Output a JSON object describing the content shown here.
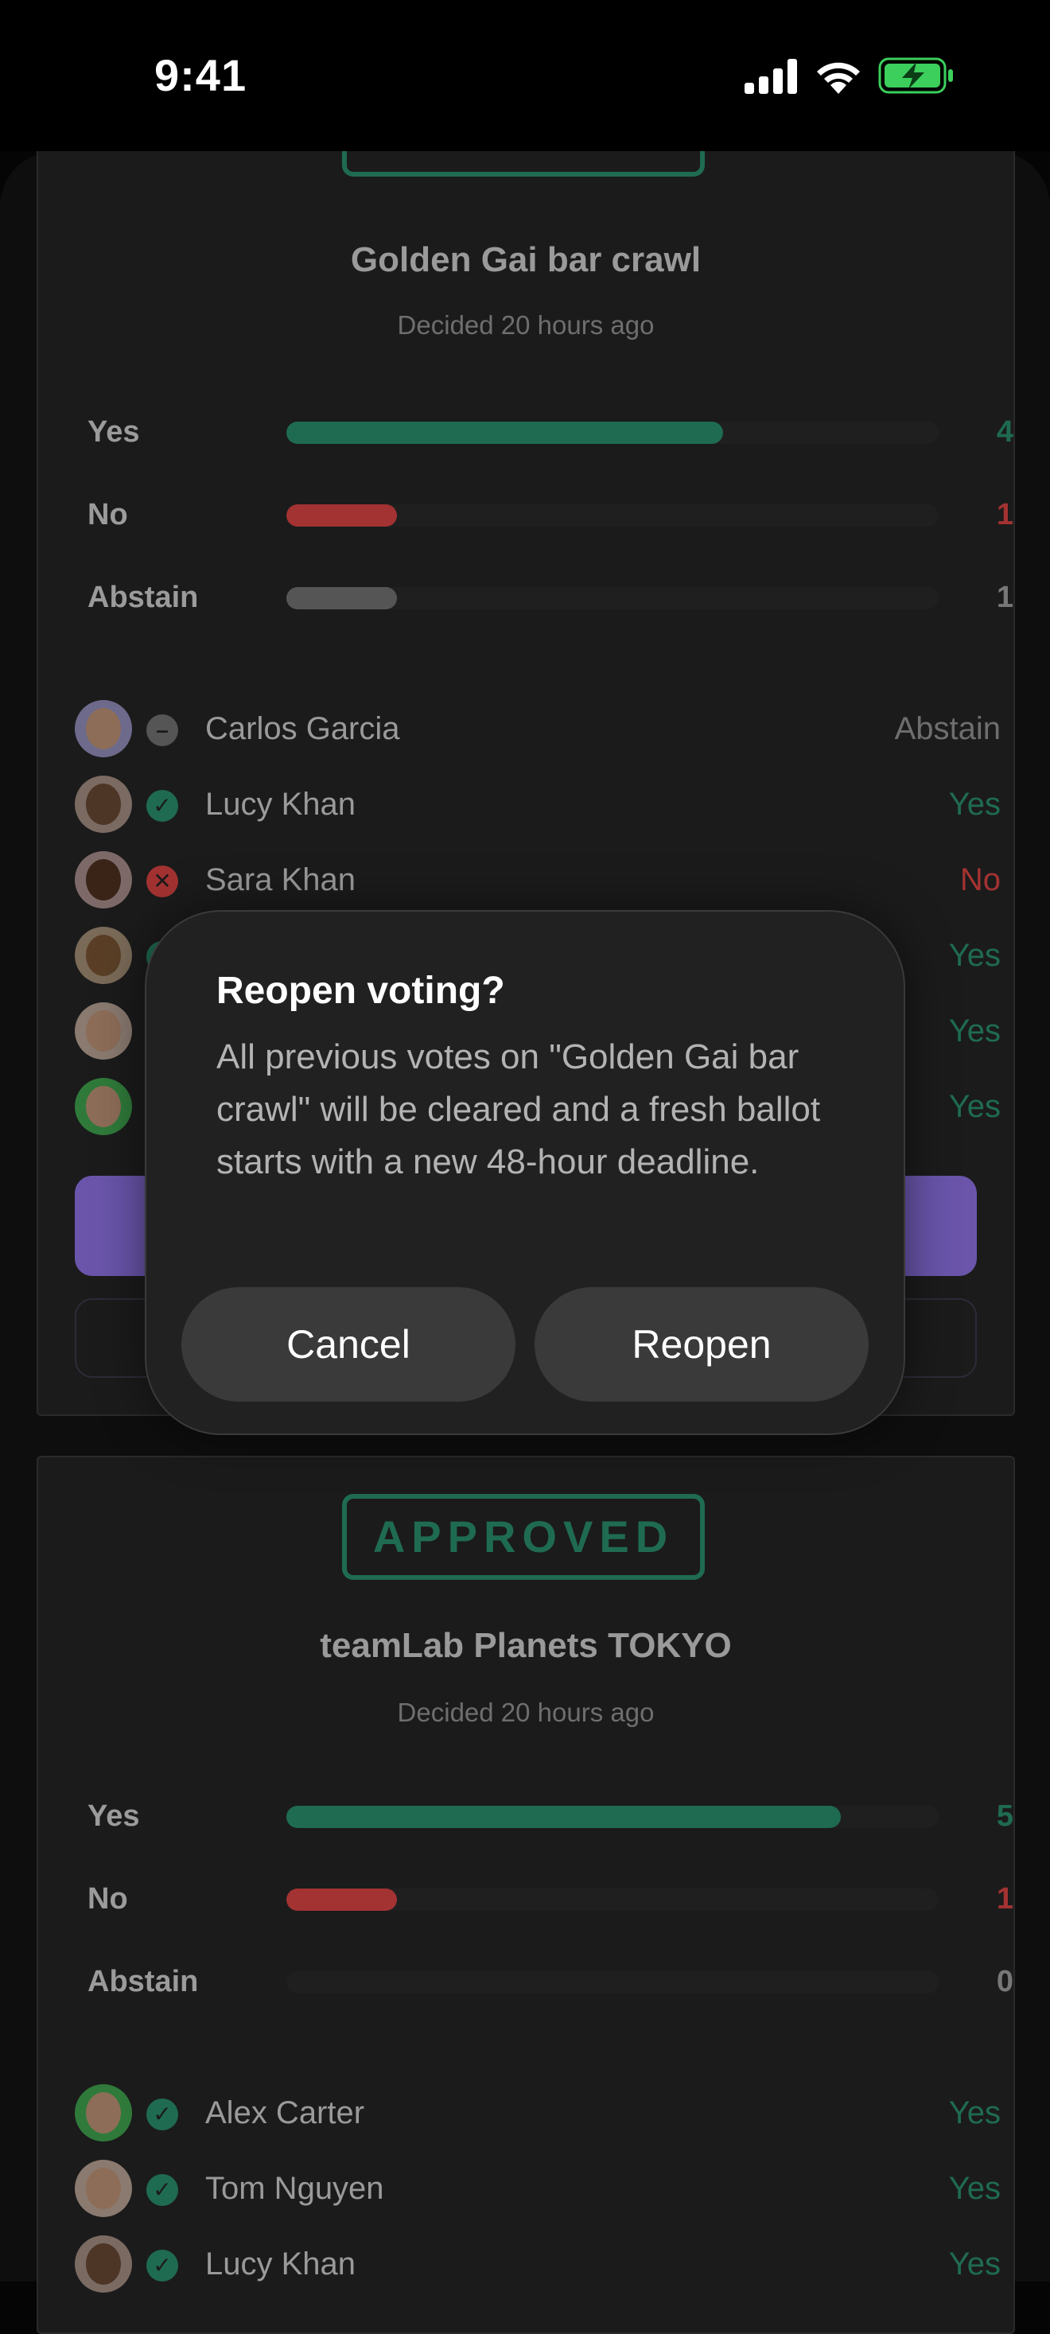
{
  "status_bar": {
    "time": "9:41"
  },
  "cards": [
    {
      "stamp": "",
      "title": "Golden Gai bar crawl",
      "decided": "Decided 20 hours ago",
      "tallies": [
        {
          "label": "Yes",
          "count": "4",
          "fraction": 0.67,
          "color": "#1f6b52"
        },
        {
          "label": "No",
          "count": "1",
          "fraction": 0.17,
          "color": "#a33232"
        },
        {
          "label": "Abstain",
          "count": "1",
          "fraction": 0.17,
          "color": "#555555"
        }
      ],
      "voters": [
        {
          "name": "Carlos Garcia",
          "vote": "Abstain"
        },
        {
          "name": "Lucy Khan",
          "vote": "Yes"
        },
        {
          "name": "Sara Khan",
          "vote": "No"
        },
        {
          "name": "",
          "vote": "Yes"
        },
        {
          "name": "",
          "vote": "Yes"
        },
        {
          "name": "",
          "vote": "Yes"
        }
      ]
    },
    {
      "stamp": "APPROVED",
      "title": "teamLab Planets TOKYO",
      "decided": "Decided 20 hours ago",
      "tallies": [
        {
          "label": "Yes",
          "count": "5",
          "fraction": 0.85,
          "color": "#1f6b52"
        },
        {
          "label": "No",
          "count": "1",
          "fraction": 0.17,
          "color": "#a33232"
        },
        {
          "label": "Abstain",
          "count": "0",
          "fraction": 0,
          "color": "#555555"
        }
      ],
      "voters": [
        {
          "name": "Alex Carter",
          "vote": "Yes"
        },
        {
          "name": "Tom Nguyen",
          "vote": "Yes"
        },
        {
          "name": "Lucy Khan",
          "vote": "Yes"
        }
      ]
    }
  ],
  "dialog": {
    "title": "Reopen voting?",
    "message": "All previous votes on \"Golden Gai bar crawl\" will be cleared and a fresh ballot starts with a new 48-hour deadline.",
    "cancel_label": "Cancel",
    "confirm_label": "Reopen"
  }
}
